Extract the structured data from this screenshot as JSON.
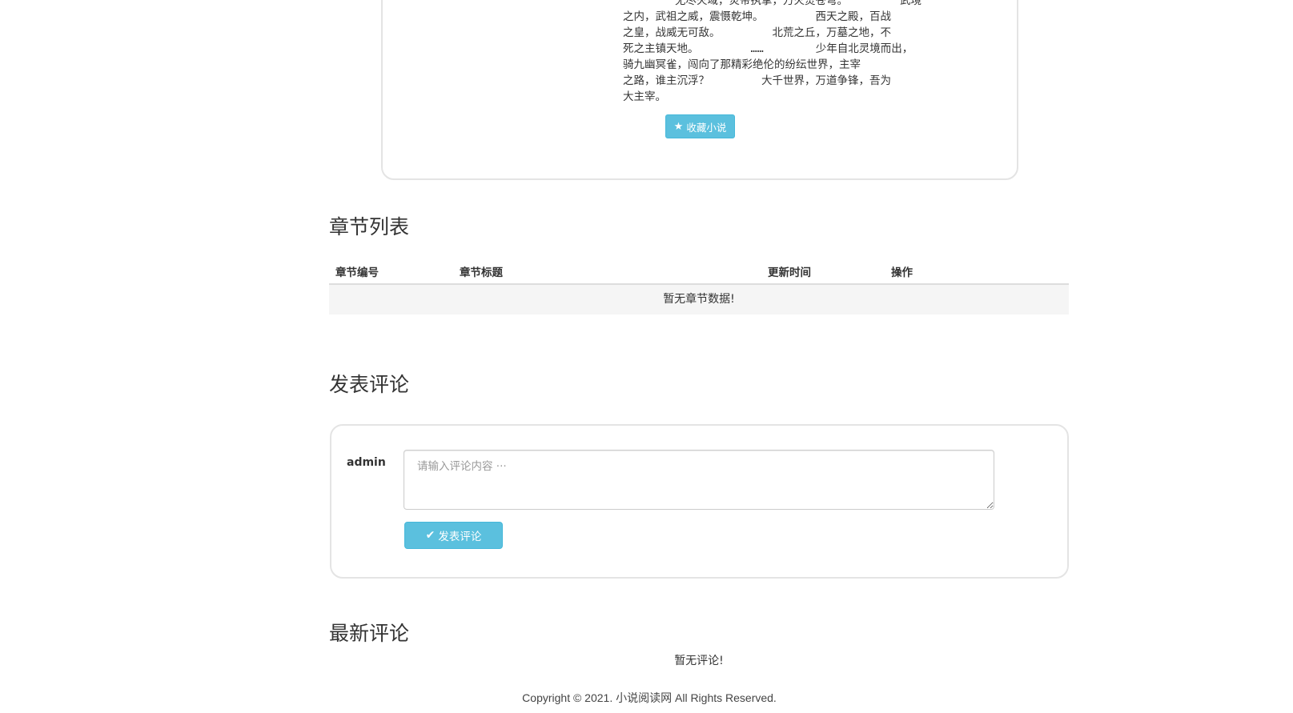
{
  "novel": {
    "intro_lines": [
      "        无尽火域，炎帝执掌，万火焚苍穹。        武境",
      "之内，武祖之威，震慑乾坤。        西天之殿，百战",
      "之皇，战威无可敌。        北荒之丘，万墓之地，不",
      "死之主镇天地。        ……        少年自北灵境而出，",
      "骑九幽冥雀，闯向了那精彩绝伦的纷纭世界，主宰",
      "之路，谁主沉浮？        大千世界，万道争锋，吾为",
      "大主宰。"
    ],
    "favorite_button": "收藏小说",
    "favorite_icon": "star-icon"
  },
  "chapters": {
    "title": "章节列表",
    "columns": [
      "章节编号",
      "章节标题",
      "更新时间",
      "操作"
    ],
    "empty_text": "暂无章节数据!"
  },
  "comment_form": {
    "title": "发表评论",
    "username": "admin",
    "placeholder": "请输入评论内容 ···",
    "value": "",
    "submit_label": "发表评论",
    "submit_icon": "check-icon"
  },
  "latest_comments": {
    "title": "最新评论",
    "empty_text": "暂无评论!"
  },
  "footer": {
    "copyright": "Copyright © 2021. 小说阅读网 All Rights Reserved."
  },
  "colors": {
    "button_info": "#5bc0de",
    "border": "#e4e4e4",
    "empty_row_bg": "#f5f5f5"
  }
}
